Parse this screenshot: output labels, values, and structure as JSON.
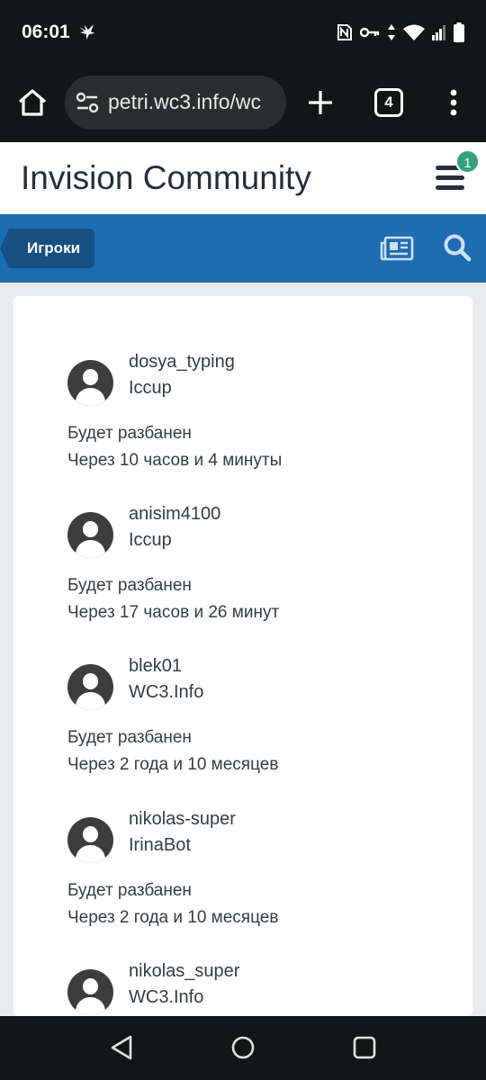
{
  "status_bar": {
    "time": "06:01"
  },
  "browser": {
    "url": "petri.wc3.info/wc",
    "tab_count": "4"
  },
  "site": {
    "title": "Invision Community",
    "notification_count": "1"
  },
  "nav": {
    "breadcrumb": "Игроки"
  },
  "entries": [
    {
      "username": "dosya_typing",
      "source": "Iccup",
      "ban_label": "Будет разбанен",
      "ban_time": "Через 10 часов и 4 минуты"
    },
    {
      "username": "anisim4100",
      "source": "Iccup",
      "ban_label": "Будет разбанен",
      "ban_time": "Через 17 часов и 26 минут"
    },
    {
      "username": "blek01",
      "source": "WC3.Info",
      "ban_label": "Будет разбанен",
      "ban_time": "Через 2 года и 10 месяцев"
    },
    {
      "username": "nikolas-super",
      "source": "IrinaBot",
      "ban_label": "Будет разбанен",
      "ban_time": "Через 2 года и 10 месяцев"
    },
    {
      "username": "nikolas_super",
      "source": "WC3.Info"
    }
  ],
  "colors": {
    "nav_blue": "#1e6db2",
    "breadcrumb_blue": "#174f83",
    "badge_green": "#34a37d",
    "system_bar": "#101716"
  },
  "icons": [
    "bird-icon",
    "nfc-icon",
    "key-icon",
    "data-arrows-icon",
    "wifi-icon",
    "signal-icon",
    "battery-icon",
    "home-icon",
    "site-settings-icon",
    "plus-icon",
    "dots-vertical-icon",
    "newspaper-icon",
    "search-icon",
    "avatar-icon",
    "back-icon",
    "circle-home-icon",
    "square-recents-icon"
  ]
}
